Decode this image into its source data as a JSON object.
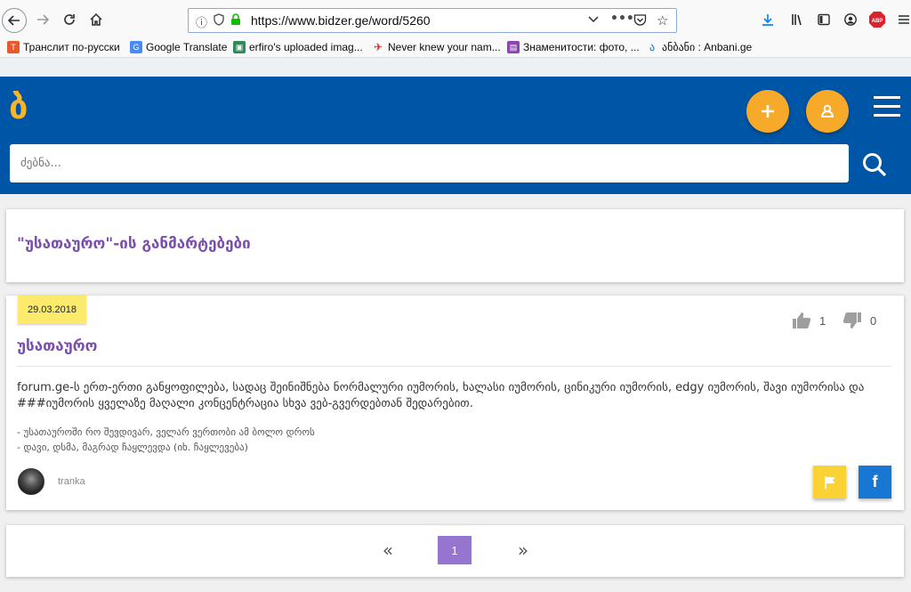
{
  "browser": {
    "url": "https://www.bidzer.ge/word/5260",
    "bookmarks": [
      {
        "label": "Транслит по-русски",
        "color": "#e55b2d"
      },
      {
        "label": "Google Translate",
        "color": "#4a8af4"
      },
      {
        "label": "erfiro's uploaded imag...",
        "color": "#2e8b57"
      },
      {
        "label": "Never knew your nam...",
        "color": "#c62828"
      },
      {
        "label": "Знаменитости: фото, ...",
        "color": "#8e44ad"
      },
      {
        "label": "ანბანი : Anbani.ge",
        "color": "#1565c0"
      }
    ],
    "abp_label": "ABP"
  },
  "site": {
    "logo": "ბ",
    "search_placeholder": "ძებნა...",
    "brand_color": "#0056a6",
    "accent_color": "#f7a929",
    "purple": "#7b4fad"
  },
  "page": {
    "title": "\"უსათაურო\"-ის განმარტებები"
  },
  "entry": {
    "date": "29.03.2018",
    "likes": "1",
    "dislikes": "0",
    "word": "უსათაურო",
    "description": "forum.ge-ს ერთ-ერთი განყოფილება, სადაც შეინიშნება ნორმალური იუმორის, ხალასი იუმორის, ცინიკური იუმორის, edgy იუმორის, შავი იუმორისა და ###იუმორის ყველაზე მაღალი კონცენტრაცია სხვა ვებ-გვერდებთან შედარებით.",
    "examples": [
      "- უსათაუროში რო შევდივარ, ველარ ვერთობი ამ ბოლო დროს",
      "- დავი, დსმა, მაგრად ჩაყლევდა (იხ. ჩაყლევება)"
    ],
    "author": "tranka"
  },
  "pagination": {
    "prev": "«",
    "current": "1",
    "next": "»"
  }
}
